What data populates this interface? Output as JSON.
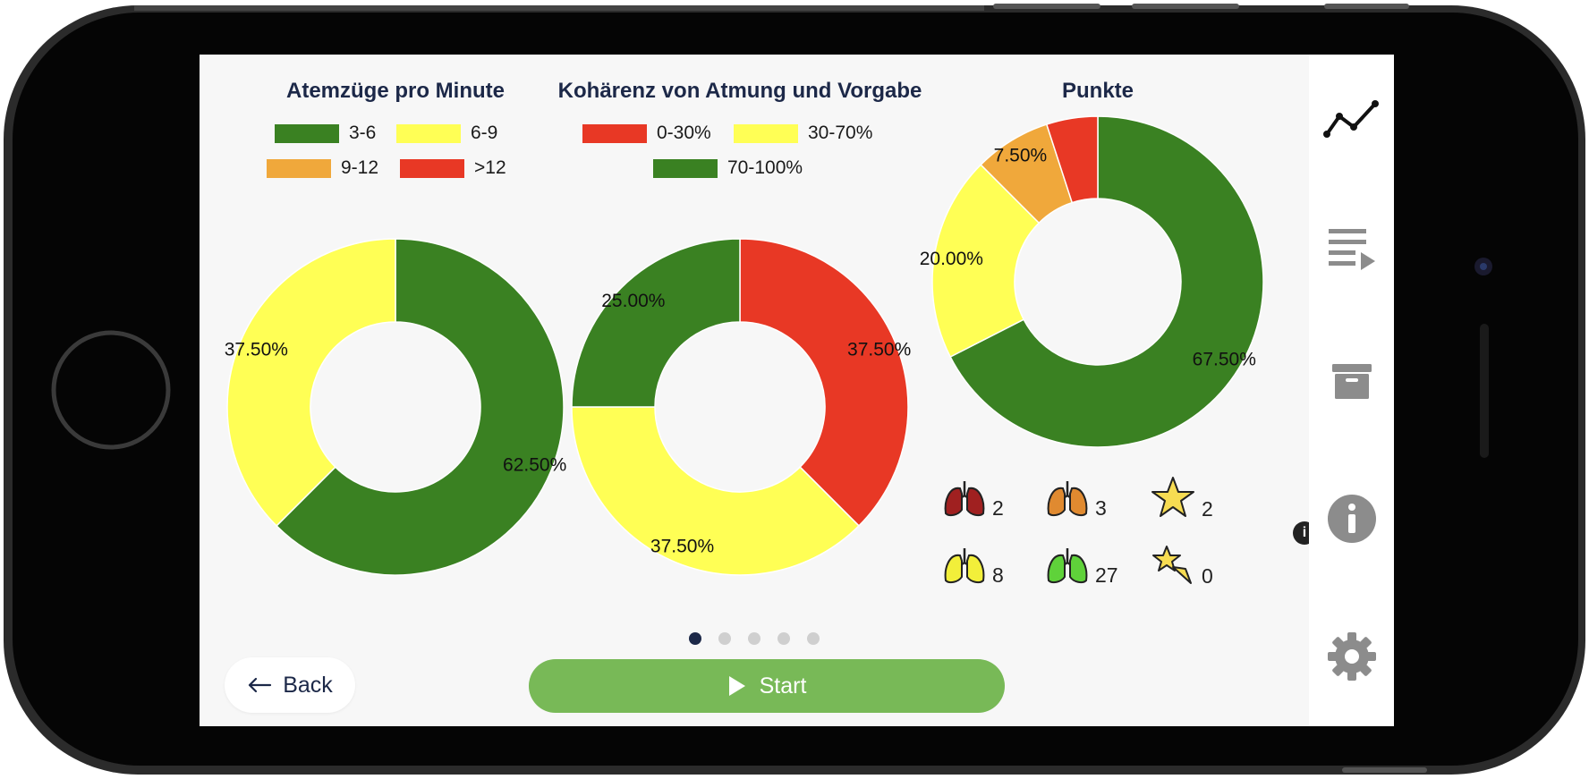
{
  "colors": {
    "green": "#3a8122",
    "yellow": "#ffff55",
    "orange": "#f0a83b",
    "red": "#e83825",
    "title": "#1c2848",
    "start_button": "#78b957",
    "icon_gray": "#8c8c8c"
  },
  "charts": {
    "breaths": {
      "title": "Atemzüge pro Minute",
      "legend": [
        {
          "label": "3-6",
          "color": "#3a8122"
        },
        {
          "label": "6-9",
          "color": "#ffff55"
        },
        {
          "label": "9-12",
          "color": "#f0a83b"
        },
        {
          "label": ">12",
          "color": "#e83825"
        }
      ]
    },
    "coherence": {
      "title": "Kohärenz von Atmung und Vorgabe",
      "legend": [
        {
          "label": "0-30%",
          "color": "#e83825"
        },
        {
          "label": "30-70%",
          "color": "#ffff55"
        },
        {
          "label": "70-100%",
          "color": "#3a8122"
        }
      ]
    },
    "points": {
      "title": "Punkte"
    }
  },
  "chart_data": [
    {
      "type": "pie",
      "title": "Atemzüge pro Minute",
      "donut": true,
      "slices": [
        {
          "label": "3-6",
          "value": 62.5,
          "text": "62.50%",
          "color": "#3a8122"
        },
        {
          "label": "6-9",
          "value": 37.5,
          "text": "37.50%",
          "color": "#ffff55"
        },
        {
          "label": "9-12",
          "value": 0,
          "text": "",
          "color": "#f0a83b"
        },
        {
          "label": ">12",
          "value": 0,
          "text": "",
          "color": "#e83825"
        }
      ]
    },
    {
      "type": "pie",
      "title": "Kohärenz von Atmung und Vorgabe",
      "donut": true,
      "slices": [
        {
          "label": "0-30%",
          "value": 37.5,
          "text": "37.50%",
          "color": "#e83825"
        },
        {
          "label": "30-70%",
          "value": 37.5,
          "text": "37.50%",
          "color": "#ffff55"
        },
        {
          "label": "70-100%",
          "value": 25.0,
          "text": "25.00%",
          "color": "#3a8122"
        }
      ]
    },
    {
      "type": "pie",
      "title": "Punkte",
      "donut": true,
      "slices": [
        {
          "value": 67.5,
          "text": "67.50%",
          "color": "#3a8122"
        },
        {
          "value": 20.0,
          "text": "20.00%",
          "color": "#ffff55"
        },
        {
          "value": 7.5,
          "text": "7.50%",
          "color": "#f0a83b"
        },
        {
          "value": 5.0,
          "text": "",
          "color": "#e83825"
        }
      ]
    }
  ],
  "stats": [
    {
      "icon": "red-lungs-icon",
      "color": "#a02020",
      "value": "2"
    },
    {
      "icon": "orange-lungs-icon",
      "color": "#e08a30",
      "value": "3"
    },
    {
      "icon": "star-icon",
      "color": "#f7dc52",
      "value": "2"
    },
    {
      "icon": "yellow-lungs-icon",
      "color": "#f2ef3a",
      "value": "8"
    },
    {
      "icon": "green-lungs-icon",
      "color": "#5fd23a",
      "value": "27"
    },
    {
      "icon": "shooting-star-icon",
      "color": "#f7dc52",
      "value": "0"
    }
  ],
  "pagination": {
    "total": 5,
    "active": 0
  },
  "buttons": {
    "back_label": "Back",
    "start_label": "Start"
  },
  "info_badge": "i",
  "sidebar": [
    {
      "icon": "chart-line-icon"
    },
    {
      "icon": "playlist-play-icon"
    },
    {
      "icon": "archive-icon"
    },
    {
      "icon": "info-icon"
    },
    {
      "icon": "settings-gear-icon"
    }
  ]
}
